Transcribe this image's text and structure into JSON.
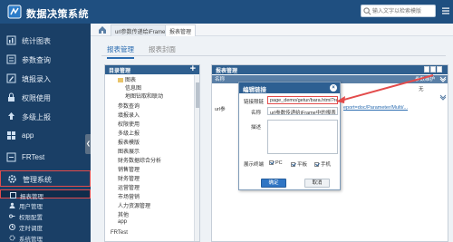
{
  "header": {
    "title": "数据决策系统",
    "search_placeholder": "输入文字以检索模版"
  },
  "sidebar": {
    "items": [
      {
        "label": "统计图表",
        "icon": "chart-icon"
      },
      {
        "label": "参数查询",
        "icon": "query-icon"
      },
      {
        "label": "填报录入",
        "icon": "form-icon"
      },
      {
        "label": "权限使用",
        "icon": "lock-icon"
      },
      {
        "label": "多级上报",
        "icon": "upload-icon"
      },
      {
        "label": "app",
        "icon": "app-icon"
      },
      {
        "label": "FRTest",
        "icon": "test-icon"
      },
      {
        "label": "管理系统",
        "icon": "gear-icon"
      }
    ],
    "sub_items": [
      {
        "label": "报表管理"
      },
      {
        "label": "用户管理"
      },
      {
        "label": "权限配置"
      },
      {
        "label": "定时调度"
      },
      {
        "label": "系统管理"
      }
    ]
  },
  "tabs": {
    "page_tabs": [
      "url参数传递给iFrame中...",
      "报表管理"
    ],
    "sub_tabs": [
      "报表管理",
      "报表封面"
    ]
  },
  "directory": {
    "title": "目录管理",
    "items": [
      "图表",
      "信息图",
      "地图钻取和联动",
      "参数查询",
      "填报录入",
      "权限使用",
      "多级上报",
      "报表模版",
      "图表展示",
      "财务数据综合分析",
      "销售管理",
      "财务管理",
      "运营管理",
      "市场营销",
      "人力资源管理",
      "其他",
      "app",
      "FRTest"
    ]
  },
  "report_panel": {
    "title": "报表管理",
    "columns": [
      "名称",
      "参数维护"
    ],
    "col3": "无",
    "row_prefix": "url参",
    "row_link": "eport=doc/Parameter/Multi/..."
  },
  "modal": {
    "title": "编辑链接",
    "link_label": "链接限链",
    "link_value": "page_demo/getur/bara.html?rep",
    "name_label": "名称",
    "name_value": "url参数传递给iFrame中的报表",
    "desc_label": "描述",
    "desc_value": "",
    "terminal_label": "展示终端",
    "terminals": [
      "PC",
      "平板",
      "手机"
    ],
    "ok_label": "确定",
    "cancel_label": "取消"
  }
}
